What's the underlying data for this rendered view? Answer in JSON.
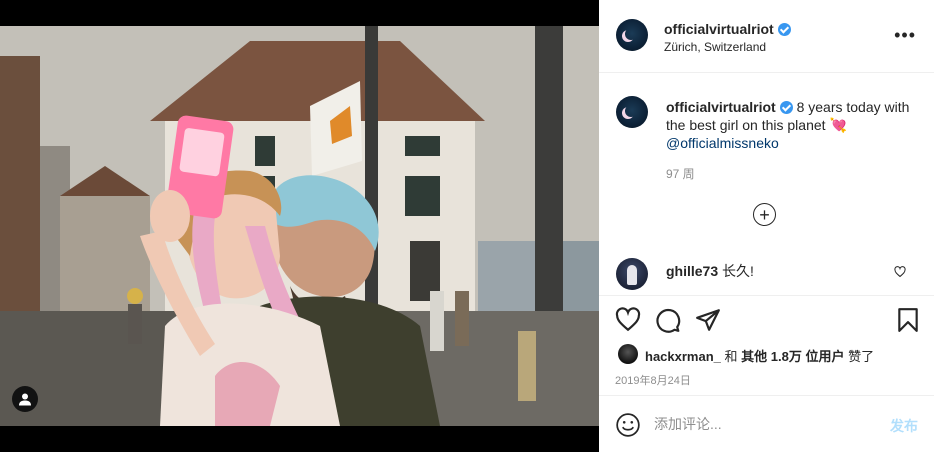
{
  "post": {
    "username": "officialvirtualriot",
    "verified": true,
    "location": "Zürich, Switzerland",
    "more_icon": "more-horizontal-icon"
  },
  "caption": {
    "username": "officialvirtualriot",
    "text": "8 years today with the best girl on this planet",
    "emoji": "💘",
    "mention": "@officialmissneko",
    "time_ago": "97 周"
  },
  "load_more_icon": "plus-circle-icon",
  "comments": [
    {
      "username": "ghille73",
      "text": "长久!"
    }
  ],
  "actions": {
    "like_icon": "heart-outline-icon",
    "comment_icon": "comment-icon",
    "share_icon": "send-icon",
    "save_icon": "bookmark-icon"
  },
  "likes": {
    "first_user": "hackxrman_",
    "conjunction": "和",
    "others": "其他 1.8万 位用户",
    "suffix": "赞了"
  },
  "date": "2019年8月24日",
  "comment_box": {
    "placeholder": "添加评论...",
    "post_label": "发布"
  },
  "colors": {
    "accent": "#3897f0",
    "mention": "#00376b",
    "muted": "#8e8e8e",
    "post_disabled": "#b2dffc"
  }
}
